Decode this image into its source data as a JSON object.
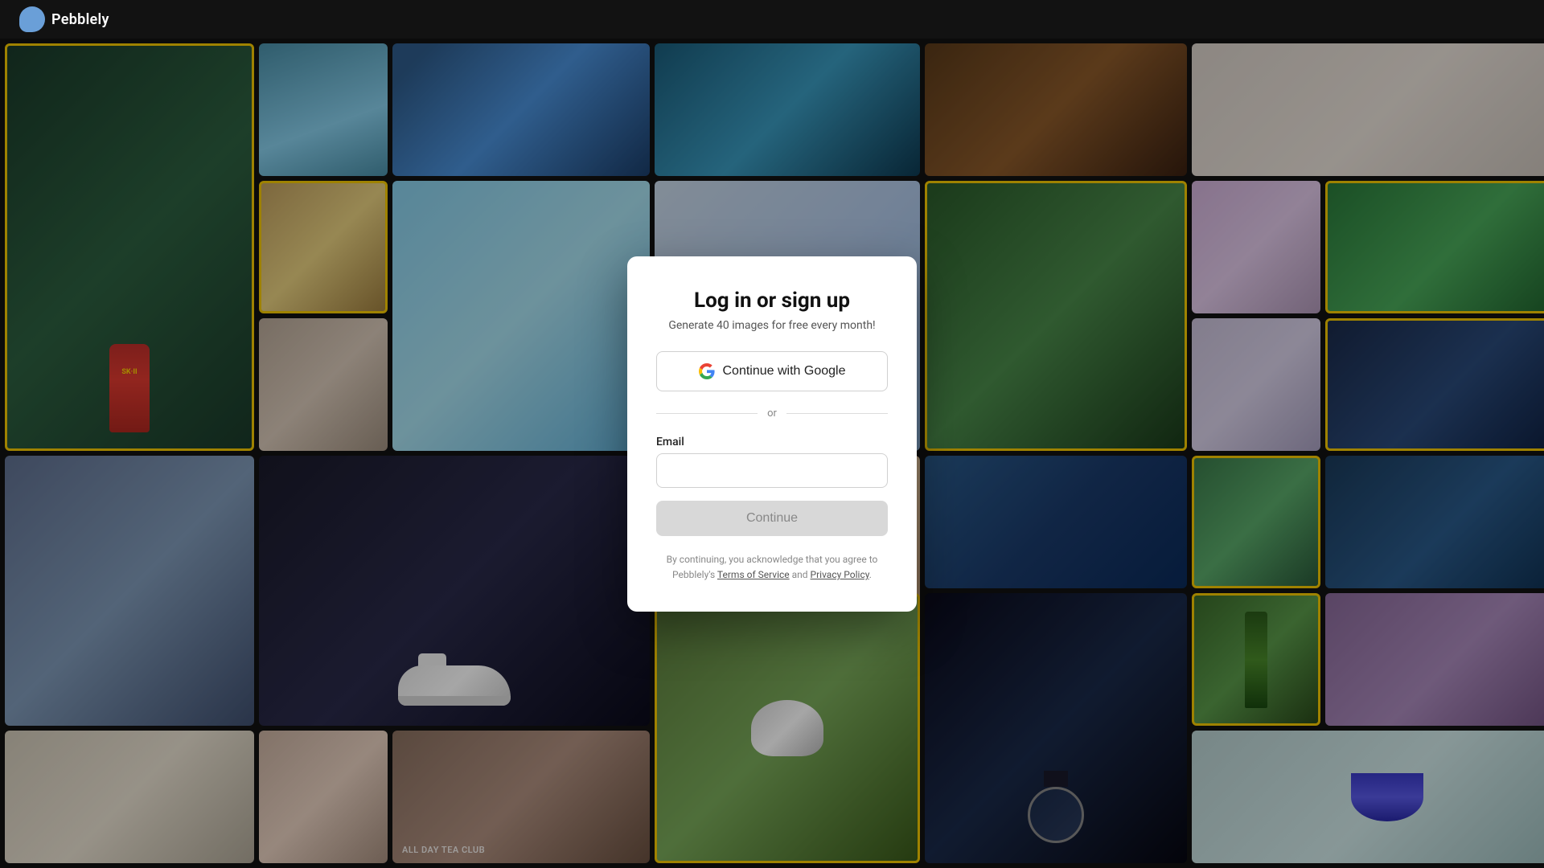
{
  "topbar": {
    "logo_text": "Pebblely",
    "logo_icon_label": "cloud-logo"
  },
  "mosaic": {
    "tiles": [
      {
        "id": "t1",
        "classes": "t1 yellow-border",
        "label": ""
      },
      {
        "id": "t2",
        "classes": "t2",
        "label": ""
      },
      {
        "id": "t3",
        "classes": "t3",
        "label": ""
      },
      {
        "id": "t4",
        "classes": "t4",
        "label": ""
      },
      {
        "id": "t5",
        "classes": "t5",
        "label": ""
      },
      {
        "id": "t6",
        "classes": "t6",
        "label": ""
      },
      {
        "id": "t7",
        "classes": "t7 yellow-border",
        "label": ""
      },
      {
        "id": "t8",
        "classes": "t8",
        "label": ""
      },
      {
        "id": "t9",
        "classes": "t9",
        "label": ""
      },
      {
        "id": "t10",
        "classes": "t10 yellow-border",
        "label": ""
      },
      {
        "id": "t11",
        "classes": "t11",
        "label": ""
      },
      {
        "id": "t12",
        "classes": "t12 yellow-border",
        "label": ""
      },
      {
        "id": "t13",
        "classes": "t13",
        "label": ""
      },
      {
        "id": "t14",
        "classes": "t14",
        "label": ""
      },
      {
        "id": "t15",
        "classes": "t15 yellow-border",
        "label": ""
      },
      {
        "id": "t16",
        "classes": "t16",
        "label": ""
      },
      {
        "id": "t17",
        "classes": "t17",
        "label": ""
      },
      {
        "id": "t18",
        "classes": "t18",
        "label": ""
      },
      {
        "id": "t19",
        "classes": "t19",
        "label": ""
      },
      {
        "id": "t20",
        "classes": "t20 yellow-border",
        "label": ""
      },
      {
        "id": "t21",
        "classes": "t21",
        "label": ""
      },
      {
        "id": "t22",
        "classes": "t22",
        "label": ""
      },
      {
        "id": "t23",
        "classes": "t23",
        "label": ""
      },
      {
        "id": "t24",
        "classes": "t24",
        "label": ""
      },
      {
        "id": "t25",
        "classes": "t25 yellow-border",
        "label": ""
      },
      {
        "id": "t26",
        "classes": "t26",
        "label": ""
      },
      {
        "id": "t27",
        "classes": "t27 yellow-border",
        "label": ""
      },
      {
        "id": "t28",
        "classes": "t28",
        "label": ""
      },
      {
        "id": "t29",
        "classes": "t29",
        "label": ""
      }
    ]
  },
  "modal": {
    "title": "Log in or sign up",
    "subtitle": "Generate 40 images for free every month!",
    "google_button_label": "Continue with Google",
    "or_divider": "or",
    "email_label": "Email",
    "email_placeholder": "",
    "continue_button_label": "Continue",
    "legal_prefix": "By continuing, you acknowledge that you agree to Pebblely's ",
    "legal_tos": "Terms of Service",
    "legal_and": " and ",
    "legal_pp": "Privacy Policy",
    "legal_suffix": "."
  }
}
